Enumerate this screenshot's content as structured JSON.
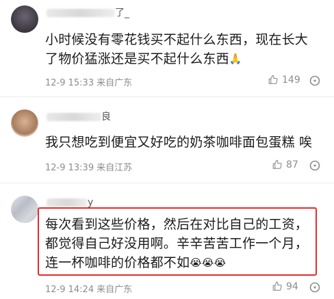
{
  "comments": [
    {
      "username_visible": "了_",
      "text_line1": "小时候没有零花钱买不起什么东西，现在长大",
      "text_line2": "了物价猛涨还是买不起什么东西",
      "emoji": "🙏",
      "date": "12-9 15:33",
      "location": "来自广东",
      "likes": "149"
    },
    {
      "username_visible": "良",
      "text_line1": "我只想吃到便宜又好吃的奶茶咖啡面包蛋糕 唉",
      "date": "12-9 13:39",
      "location": "来自江苏",
      "likes": "87"
    },
    {
      "username_visible": "y",
      "text_line1": "每次看到这些价格，然后在对比自己的工资，",
      "text_line2": "都觉得自己好没用啊。辛辛苦苦工作一个月，",
      "text_line3": "连一杯咖啡的价格都不如",
      "emoji": "😭😭😭",
      "date": "12-9 14:24",
      "location": "来自广东",
      "likes": "94"
    }
  ],
  "colors": {
    "highlight": "#e52b2b",
    "meta": "#8c8c8c",
    "separator": "#ececec"
  },
  "icons": {
    "like": "thumbs-up-icon",
    "more": "more-icon"
  }
}
